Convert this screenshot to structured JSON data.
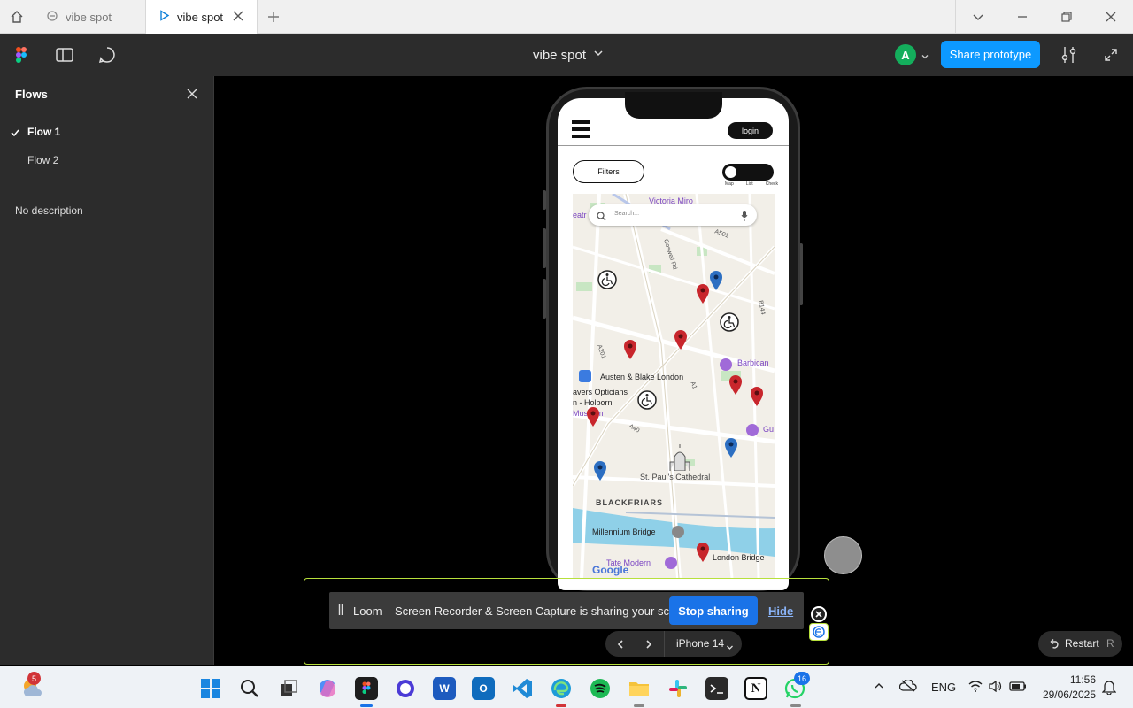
{
  "browser": {
    "tabs": [
      {
        "label": "vibe spot"
      },
      {
        "label": "vibe spot"
      }
    ]
  },
  "toolbar": {
    "file_title": "vibe spot",
    "avatar_initial": "A",
    "share_label": "Share prototype"
  },
  "flows_panel": {
    "title": "Flows",
    "items": [
      {
        "label": "Flow 1",
        "selected": true
      },
      {
        "label": "Flow 2",
        "selected": false
      }
    ],
    "description": "No description"
  },
  "app": {
    "login_label": "login",
    "filters_label": "Filters",
    "view_toggle_labels": [
      "Map",
      "List",
      "Check"
    ],
    "search_placeholder": "Search...",
    "map_labels": {
      "victoria_miro": "Victoria Miro",
      "goswell_rd": "Goswell Rd",
      "a501": "A501",
      "b144": "B144",
      "a201": "A201",
      "a1": "A1",
      "a40": "A40",
      "barbican": "Barbican",
      "austen_blake": "Austen & Blake London",
      "opticians": "avers Opticians",
      "holborn": "n - Holborn",
      "museum": "Museum",
      "gu": "Gu",
      "st_pauls": "St. Paul's Cathedral",
      "blackfriars": "BLACKFRIARS",
      "millennium_bridge": "Millennium Bridge",
      "tate_modern": "Tate Modern",
      "london_bridge": "London Bridge",
      "google": "Google",
      "eat": "eatr"
    }
  },
  "loom": {
    "message": "Loom – Screen Recorder & Screen Capture is sharing your screen.",
    "stop_label": "Stop sharing",
    "hide_label": "Hide"
  },
  "device": {
    "label": "iPhone 14"
  },
  "restart": {
    "label": "Restart",
    "shortcut": "R"
  },
  "taskbar": {
    "weather_badge": "5",
    "whatsapp_badge": "16",
    "language": "ENG",
    "time": "11:56",
    "date": "29/06/2025"
  },
  "colors": {
    "accent": "#0d99ff",
    "avatar": "#14ae5c",
    "pin_red": "#c8262c",
    "pin_blue": "#2d6fc2",
    "loom_highlight": "#b7e03c"
  }
}
